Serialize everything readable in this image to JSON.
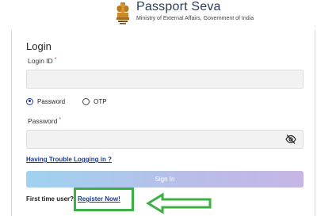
{
  "header": {
    "brand_title": "Passport Seva",
    "brand_subtitle": "Ministry of External Affairs, Government of India"
  },
  "login": {
    "title": "Login",
    "login_id_label": "Login ID",
    "required_mark": "*",
    "auth_options": [
      {
        "label": "Password",
        "selected": true
      },
      {
        "label": "OTP",
        "selected": false
      }
    ],
    "password_label": "Password",
    "trouble_link": "Having Trouble Logging in ?",
    "sign_in_label": "Sign In",
    "first_time_text": "First time user?",
    "register_link": "Register Now!"
  },
  "colors": {
    "link": "#1a3a8f",
    "highlight": "#3cb043",
    "required": "#e53935"
  },
  "icons": {
    "emblem": "national-emblem-icon",
    "password_visibility": "eye-slash-icon",
    "annotation_arrow": "left-arrow-icon"
  }
}
